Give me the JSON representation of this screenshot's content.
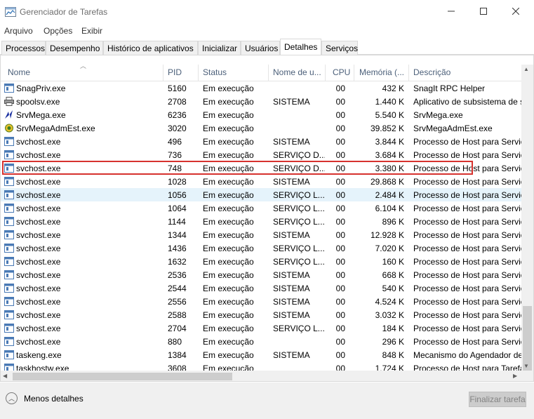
{
  "window": {
    "title": "Gerenciador de Tarefas"
  },
  "menu": [
    "Arquivo",
    "Opções",
    "Exibir"
  ],
  "tabs": [
    "Processos",
    "Desempenho",
    "Histórico de aplicativos",
    "Inicializar",
    "Usuários",
    "Detalhes",
    "Serviços"
  ],
  "active_tab": "Detalhes",
  "columns": [
    "Nome",
    "PID",
    "Status",
    "Nome de u...",
    "CPU",
    "Memória (...",
    "Descrição"
  ],
  "rows": [
    {
      "name": "SnagPriv.exe",
      "pid": "5160",
      "status": "Em execução",
      "user": "",
      "cpu": "00",
      "mem": "432 K",
      "desc": "SnagIt RPC Helper",
      "icon": "app-icon"
    },
    {
      "name": "spoolsv.exe",
      "pid": "2708",
      "status": "Em execução",
      "user": "SISTEMA",
      "cpu": "00",
      "mem": "1.440 K",
      "desc": "Aplicativo de subsistema de s",
      "icon": "printer-icon"
    },
    {
      "name": "SrvMega.exe",
      "pid": "6236",
      "status": "Em execução",
      "user": "",
      "cpu": "00",
      "mem": "5.540 K",
      "desc": "SrvMega.exe",
      "icon": "srvmega-icon"
    },
    {
      "name": "SrvMegaAdmEst.exe",
      "pid": "3020",
      "status": "Em execução",
      "user": "",
      "cpu": "00",
      "mem": "39.852 K",
      "desc": "SrvMegaAdmEst.exe",
      "icon": "gear-flower-icon"
    },
    {
      "name": "svchost.exe",
      "pid": "496",
      "status": "Em execução",
      "user": "SISTEMA",
      "cpu": "00",
      "mem": "3.844 K",
      "desc": "Processo de Host para Serviço",
      "icon": "service-host-icon"
    },
    {
      "name": "svchost.exe",
      "pid": "736",
      "status": "Em execução",
      "user": "SERVIÇO D...",
      "cpu": "00",
      "mem": "3.684 K",
      "desc": "Processo de Host para Serviço",
      "icon": "service-host-icon"
    },
    {
      "name": "svchost.exe",
      "pid": "748",
      "status": "Em execução",
      "user": "SERVIÇO D...",
      "cpu": "00",
      "mem": "3.380 K",
      "desc": "Processo de Host para Serviço",
      "icon": "service-host-icon"
    },
    {
      "name": "svchost.exe",
      "pid": "1028",
      "status": "Em execução",
      "user": "SISTEMA",
      "cpu": "00",
      "mem": "29.868 K",
      "desc": "Processo de Host para Serviço",
      "icon": "service-host-icon"
    },
    {
      "name": "svchost.exe",
      "pid": "1056",
      "status": "Em execução",
      "user": "SERVIÇO L...",
      "cpu": "00",
      "mem": "2.484 K",
      "desc": "Processo de Host para Serviço",
      "icon": "service-host-icon"
    },
    {
      "name": "svchost.exe",
      "pid": "1064",
      "status": "Em execução",
      "user": "SERVIÇO L...",
      "cpu": "00",
      "mem": "6.104 K",
      "desc": "Processo de Host para Serviço",
      "icon": "service-host-icon"
    },
    {
      "name": "svchost.exe",
      "pid": "1144",
      "status": "Em execução",
      "user": "SERVIÇO L...",
      "cpu": "00",
      "mem": "896 K",
      "desc": "Processo de Host para Serviço",
      "icon": "service-host-icon"
    },
    {
      "name": "svchost.exe",
      "pid": "1344",
      "status": "Em execução",
      "user": "SISTEMA",
      "cpu": "00",
      "mem": "12.928 K",
      "desc": "Processo de Host para Serviço",
      "icon": "service-host-icon"
    },
    {
      "name": "svchost.exe",
      "pid": "1436",
      "status": "Em execução",
      "user": "SERVIÇO L...",
      "cpu": "00",
      "mem": "7.020 K",
      "desc": "Processo de Host para Serviço",
      "icon": "service-host-icon"
    },
    {
      "name": "svchost.exe",
      "pid": "1632",
      "status": "Em execução",
      "user": "SERVIÇO L...",
      "cpu": "00",
      "mem": "160 K",
      "desc": "Processo de Host para Serviço",
      "icon": "service-host-icon"
    },
    {
      "name": "svchost.exe",
      "pid": "2536",
      "status": "Em execução",
      "user": "SISTEMA",
      "cpu": "00",
      "mem": "668 K",
      "desc": "Processo de Host para Serviço",
      "icon": "service-host-icon"
    },
    {
      "name": "svchost.exe",
      "pid": "2544",
      "status": "Em execução",
      "user": "SISTEMA",
      "cpu": "00",
      "mem": "540 K",
      "desc": "Processo de Host para Serviço",
      "icon": "service-host-icon"
    },
    {
      "name": "svchost.exe",
      "pid": "2556",
      "status": "Em execução",
      "user": "SISTEMA",
      "cpu": "00",
      "mem": "4.524 K",
      "desc": "Processo de Host para Serviço",
      "icon": "service-host-icon"
    },
    {
      "name": "svchost.exe",
      "pid": "2588",
      "status": "Em execução",
      "user": "SISTEMA",
      "cpu": "00",
      "mem": "3.032 K",
      "desc": "Processo de Host para Serviço",
      "icon": "service-host-icon"
    },
    {
      "name": "svchost.exe",
      "pid": "2704",
      "status": "Em execução",
      "user": "SERVIÇO L...",
      "cpu": "00",
      "mem": "184 K",
      "desc": "Processo de Host para Serviço",
      "icon": "service-host-icon"
    },
    {
      "name": "svchost.exe",
      "pid": "880",
      "status": "Em execução",
      "user": "",
      "cpu": "00",
      "mem": "296 K",
      "desc": "Processo de Host para Serviço",
      "icon": "service-host-icon"
    },
    {
      "name": "taskeng.exe",
      "pid": "1384",
      "status": "Em execução",
      "user": "SISTEMA",
      "cpu": "00",
      "mem": "848 K",
      "desc": "Mecanismo do Agendador de",
      "icon": "app-icon"
    },
    {
      "name": "taskhostw.exe",
      "pid": "3608",
      "status": "Em execução",
      "user": "",
      "cpu": "00",
      "mem": "1.724 K",
      "desc": "Processo de Host para Tarefas",
      "icon": "app-icon"
    }
  ],
  "highlighted_row_pid": "1056",
  "outlined_row_pid": "6236",
  "footer": {
    "less_details": "Menos detalhes",
    "end_task": "Finalizar tarefa"
  },
  "colors": {
    "highlight": "#e5f3fb",
    "outline": "#d6322e",
    "header_text": "#4c607a"
  }
}
